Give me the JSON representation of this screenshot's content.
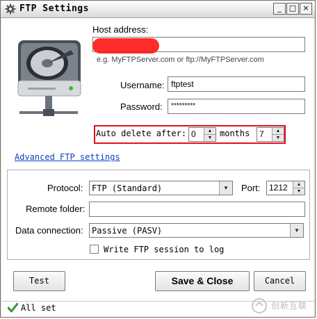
{
  "window": {
    "title": "FTP Settings"
  },
  "titlebar": {
    "min_glyph": "_",
    "max_glyph": "□",
    "close_glyph": "×"
  },
  "form": {
    "host_label": "Host address:",
    "host_value": "",
    "host_hint": "e.g. MyFTPServer.com or ftp://MyFTPServer.com",
    "username_label": "Username:",
    "username_value": "ftptest",
    "password_label": "Password:",
    "password_value": "*********",
    "auto_delete_label": "Auto delete after:",
    "auto_delete_value": "0",
    "months_label": "months",
    "months_value": "7",
    "advanced_link": "Advanced FTP settings"
  },
  "advanced": {
    "protocol_label": "Protocol:",
    "protocol_value": "FTP (Standard)",
    "port_label": "Port:",
    "port_value": "1212",
    "remote_folder_label": "Remote folder:",
    "remote_folder_value": "",
    "data_connection_label": "Data connection:",
    "data_connection_value": "Passive (PASV)",
    "write_log_label": "Write FTP session to log",
    "write_log_checked": false
  },
  "buttons": {
    "test": "Test",
    "save_close": "Save & Close",
    "cancel": "Cancel"
  },
  "status": {
    "text": "All set",
    "icon": "checkmark-icon",
    "color": "#2e9a2e"
  },
  "watermark": {
    "text": "创新互联"
  },
  "colors": {
    "highlight_border": "#e0101a",
    "link": "#0b3ec2"
  }
}
